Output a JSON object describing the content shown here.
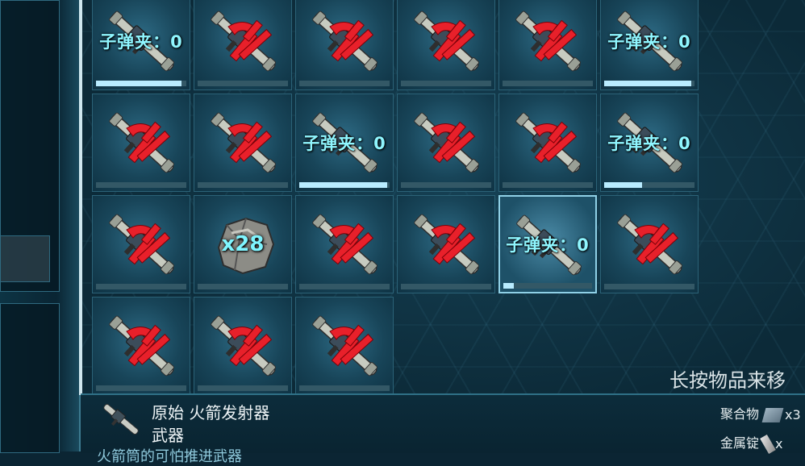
{
  "inventory": {
    "slots": [
      {
        "type": "weapon",
        "broken": false,
        "ammo_label": "子弹夹：0",
        "durability": 0.95
      },
      {
        "type": "weapon",
        "broken": true,
        "durability": 0
      },
      {
        "type": "weapon",
        "broken": true,
        "durability": 0
      },
      {
        "type": "weapon",
        "broken": true,
        "durability": 0
      },
      {
        "type": "weapon",
        "broken": true,
        "durability": 0
      },
      {
        "type": "weapon",
        "broken": false,
        "ammo_label": "子弹夹：0",
        "durability": 0.96
      },
      {
        "type": "weapon",
        "broken": true,
        "durability": 0
      },
      {
        "type": "weapon",
        "broken": true,
        "durability": 0
      },
      {
        "type": "weapon",
        "broken": false,
        "ammo_label": "子弹夹：0",
        "durability": 0.97
      },
      {
        "type": "weapon",
        "broken": true,
        "durability": 0
      },
      {
        "type": "weapon",
        "broken": true,
        "durability": 0
      },
      {
        "type": "weapon",
        "broken": false,
        "ammo_label": "子弹夹：0",
        "durability": 0.42
      },
      {
        "type": "weapon",
        "broken": true,
        "durability": 0
      },
      {
        "type": "resource",
        "quantity_label": "x28",
        "durability": 0
      },
      {
        "type": "weapon",
        "broken": true,
        "durability": 0
      },
      {
        "type": "weapon",
        "broken": true,
        "durability": 0
      },
      {
        "type": "weapon",
        "broken": false,
        "selected": true,
        "ammo_label": "子弹夹：0",
        "durability": 0.12
      },
      {
        "type": "weapon",
        "broken": true,
        "durability": 0
      },
      {
        "type": "weapon",
        "broken": true,
        "durability": 0
      },
      {
        "type": "weapon",
        "broken": true,
        "durability": 0
      },
      {
        "type": "weapon",
        "broken": true,
        "durability": 0
      }
    ]
  },
  "hint": "长按物品来移",
  "details": {
    "name": "原始 火箭发射器",
    "type": "武器",
    "description": "火箭筒的可怕推进武器"
  },
  "resources": [
    {
      "label": "聚合物",
      "icon": "polymer-icon",
      "count": "x3"
    },
    {
      "label": "金属锭",
      "icon": "metal-ingot-icon",
      "count": "x"
    }
  ],
  "colors": {
    "ammo_text": "#8ff6ff",
    "broken_mark": "#e8202a",
    "durability_fill": "#b9ecff"
  }
}
